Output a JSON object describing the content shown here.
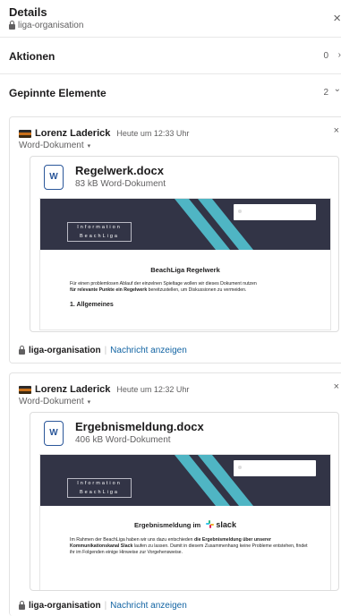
{
  "header": {
    "title": "Details",
    "channel": "liga-organisation",
    "close_symbol": "×"
  },
  "sections": {
    "actions": {
      "label": "Aktionen",
      "count": "0",
      "chevron": "›"
    },
    "pinned": {
      "label": "Gepinnte Elemente",
      "count": "2",
      "chevron": "⌄"
    }
  },
  "pins": [
    {
      "author": "Lorenz Laderick",
      "time": "Heute um 12:33 Uhr",
      "doc_type": "Word-Dokument",
      "caret": "▾",
      "close_symbol": "×",
      "file_name": "Regelwerk.docx",
      "file_meta": "83 kB Word-Dokument",
      "icon_letter": "W",
      "preview": {
        "band_line1": "Information",
        "band_line2": "BeachLiga",
        "heading": "BeachLiga Regelwerk",
        "text_normal": "Für einen problemlosen Ablauf der einzelnen Spieltage wollen wir dieses Dokument nutzen",
        "text_bold": "für relevante Punkte ein Regelwerk",
        "text_tail": " bereitzustellen, um Diskussionen zu vermeiden.",
        "subheading": "1. Allgemeines"
      },
      "footer_channel": "liga-organisation",
      "footer_link": "Nachricht anzeigen"
    },
    {
      "author": "Lorenz Laderick",
      "time": "Heute um 12:32 Uhr",
      "doc_type": "Word-Dokument",
      "caret": "▾",
      "close_symbol": "×",
      "file_name": "Ergebnismeldung.docx",
      "file_meta": "406 kB Word-Dokument",
      "icon_letter": "W",
      "preview": {
        "band_line1": "Information",
        "band_line2": "BeachLiga",
        "heading": "Ergebnismeldung im",
        "heading_brand": "slack",
        "text_a": "Im Rahmen der BeachLiga haben wir uns dazu entschieden ",
        "text_b": "die Ergebnismeldung über unserer Kommunikationskanal Slack",
        "text_c": " laufen zu lassen. Damit in diesem Zusammenhang keine Probleme entstehen, findet ihr im Folgenden einige Hinweise zur Vorgehensweise."
      },
      "footer_channel": "liga-organisation",
      "footer_link": "Nachricht anzeigen"
    }
  ],
  "colors": {
    "link": "#1264a3",
    "word_blue": "#2b579a",
    "band": "#323446",
    "stripe": "#4fb5c4"
  }
}
